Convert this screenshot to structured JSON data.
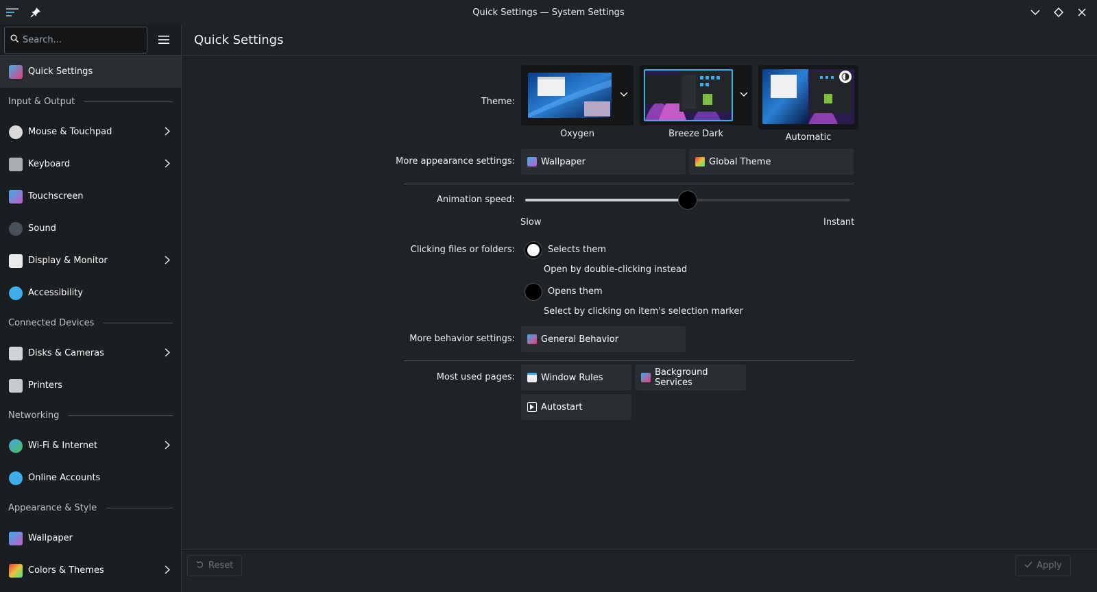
{
  "window": {
    "title": "Quick Settings — System Settings"
  },
  "search": {
    "placeholder": "Search..."
  },
  "header": {
    "page_title": "Quick Settings"
  },
  "sidebar": {
    "items": [
      {
        "type": "item",
        "label": "Quick Settings",
        "icon": "quick-settings-icon",
        "active": true,
        "chevron": false
      },
      {
        "type": "category",
        "label": "Input & Output"
      },
      {
        "type": "item",
        "label": "Mouse & Touchpad",
        "icon": "mouse-icon",
        "chevron": true
      },
      {
        "type": "item",
        "label": "Keyboard",
        "icon": "keyboard-icon",
        "chevron": true
      },
      {
        "type": "item",
        "label": "Touchscreen",
        "icon": "touchscreen-icon",
        "chevron": false
      },
      {
        "type": "item",
        "label": "Sound",
        "icon": "sound-icon",
        "chevron": false
      },
      {
        "type": "item",
        "label": "Display & Monitor",
        "icon": "display-icon",
        "chevron": true
      },
      {
        "type": "item",
        "label": "Accessibility",
        "icon": "accessibility-icon",
        "chevron": false
      },
      {
        "type": "category",
        "label": "Connected Devices"
      },
      {
        "type": "item",
        "label": "Disks & Cameras",
        "icon": "disk-icon",
        "chevron": true
      },
      {
        "type": "item",
        "label": "Printers",
        "icon": "printer-icon",
        "chevron": false
      },
      {
        "type": "category",
        "label": "Networking"
      },
      {
        "type": "item",
        "label": "Wi-Fi & Internet",
        "icon": "globe-icon",
        "chevron": true
      },
      {
        "type": "item",
        "label": "Online Accounts",
        "icon": "online-accounts-icon",
        "chevron": false
      },
      {
        "type": "category",
        "label": "Appearance & Style"
      },
      {
        "type": "item",
        "label": "Wallpaper",
        "icon": "wallpaper-icon",
        "chevron": false
      },
      {
        "type": "item",
        "label": "Colors & Themes",
        "icon": "colors-themes-icon",
        "chevron": true
      }
    ]
  },
  "theme": {
    "label": "Theme:",
    "options": [
      {
        "name": "Oxygen",
        "selected": false
      },
      {
        "name": "Breeze Dark",
        "selected": true
      },
      {
        "name": "Automatic",
        "selected": false
      }
    ]
  },
  "appearance": {
    "label": "More appearance settings:",
    "wallpaper": "Wallpaper",
    "global_theme": "Global Theme"
  },
  "animation": {
    "label": "Animation speed:",
    "slow": "Slow",
    "instant": "Instant",
    "value": 0.5
  },
  "clicking": {
    "label": "Clicking files or folders:",
    "selects": "Selects them",
    "selects_hint": "Open by double-clicking instead",
    "opens": "Opens them",
    "opens_hint": "Select by clicking on item's selection marker"
  },
  "behavior": {
    "label": "More behavior settings:",
    "general": "General Behavior"
  },
  "most_used": {
    "label": "Most used pages:",
    "window_rules": "Window Rules",
    "background_services": "Background Services",
    "autostart": "Autostart"
  },
  "footer": {
    "reset": "Reset",
    "apply": "Apply"
  },
  "colors": {
    "accent": "#3daee9",
    "background": "#202326",
    "sidebar": "#1b1e20"
  }
}
